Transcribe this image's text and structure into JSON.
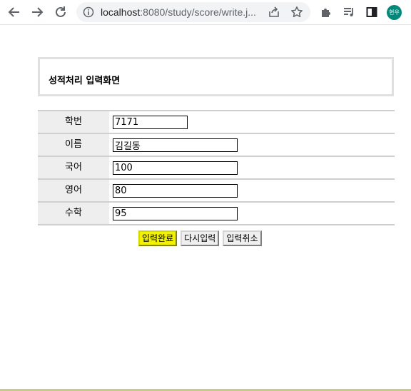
{
  "browser": {
    "url_host": "localhost",
    "url_path": ":8080/study/score/write.j...",
    "avatar_text": "현우",
    "colors": {
      "avatar": "#00897b",
      "omnibox": "#f1f3f4"
    }
  },
  "page": {
    "title": "성적처리 입력화면",
    "fields": [
      {
        "label": "학번",
        "value": "7171"
      },
      {
        "label": "이름",
        "value": "김길동"
      },
      {
        "label": "국어",
        "value": "100"
      },
      {
        "label": "영어",
        "value": "80"
      },
      {
        "label": "수학",
        "value": "95"
      }
    ],
    "buttons": {
      "submit": "입력완료",
      "reset": "다시입력",
      "cancel": "입력취소"
    },
    "colors": {
      "label_bg": "#eeeeee",
      "submit_highlight": "#f1f100"
    }
  }
}
